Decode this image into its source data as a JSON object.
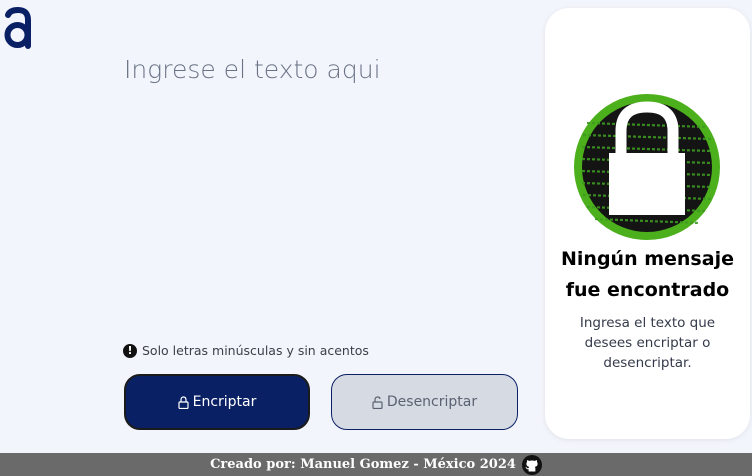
{
  "brand": {
    "logo": "a"
  },
  "input": {
    "placeholder": "Ingrese el texto aqui",
    "value": ""
  },
  "hint": {
    "icon": "exclamation-icon",
    "text": "Solo letras minúsculas y sin acentos"
  },
  "buttons": {
    "encrypt": {
      "label": "Encriptar",
      "icon": "lock-icon"
    },
    "decrypt": {
      "label": "Desencriptar",
      "icon": "unlock-icon"
    }
  },
  "result": {
    "title": "Ningún mensaje fue encontrado",
    "description": "Ingresa el texto que desees encriptar o desencriptar.",
    "image_icon": "padlock-code-icon"
  },
  "footer": {
    "text": "Creado por: Manuel Gomez - México 2024",
    "icon": "github-icon"
  },
  "colors": {
    "primary": "#0a2064",
    "background": "#f3f5fc",
    "footer": "#6a6a6a",
    "accent_green": "#4caf1c"
  }
}
